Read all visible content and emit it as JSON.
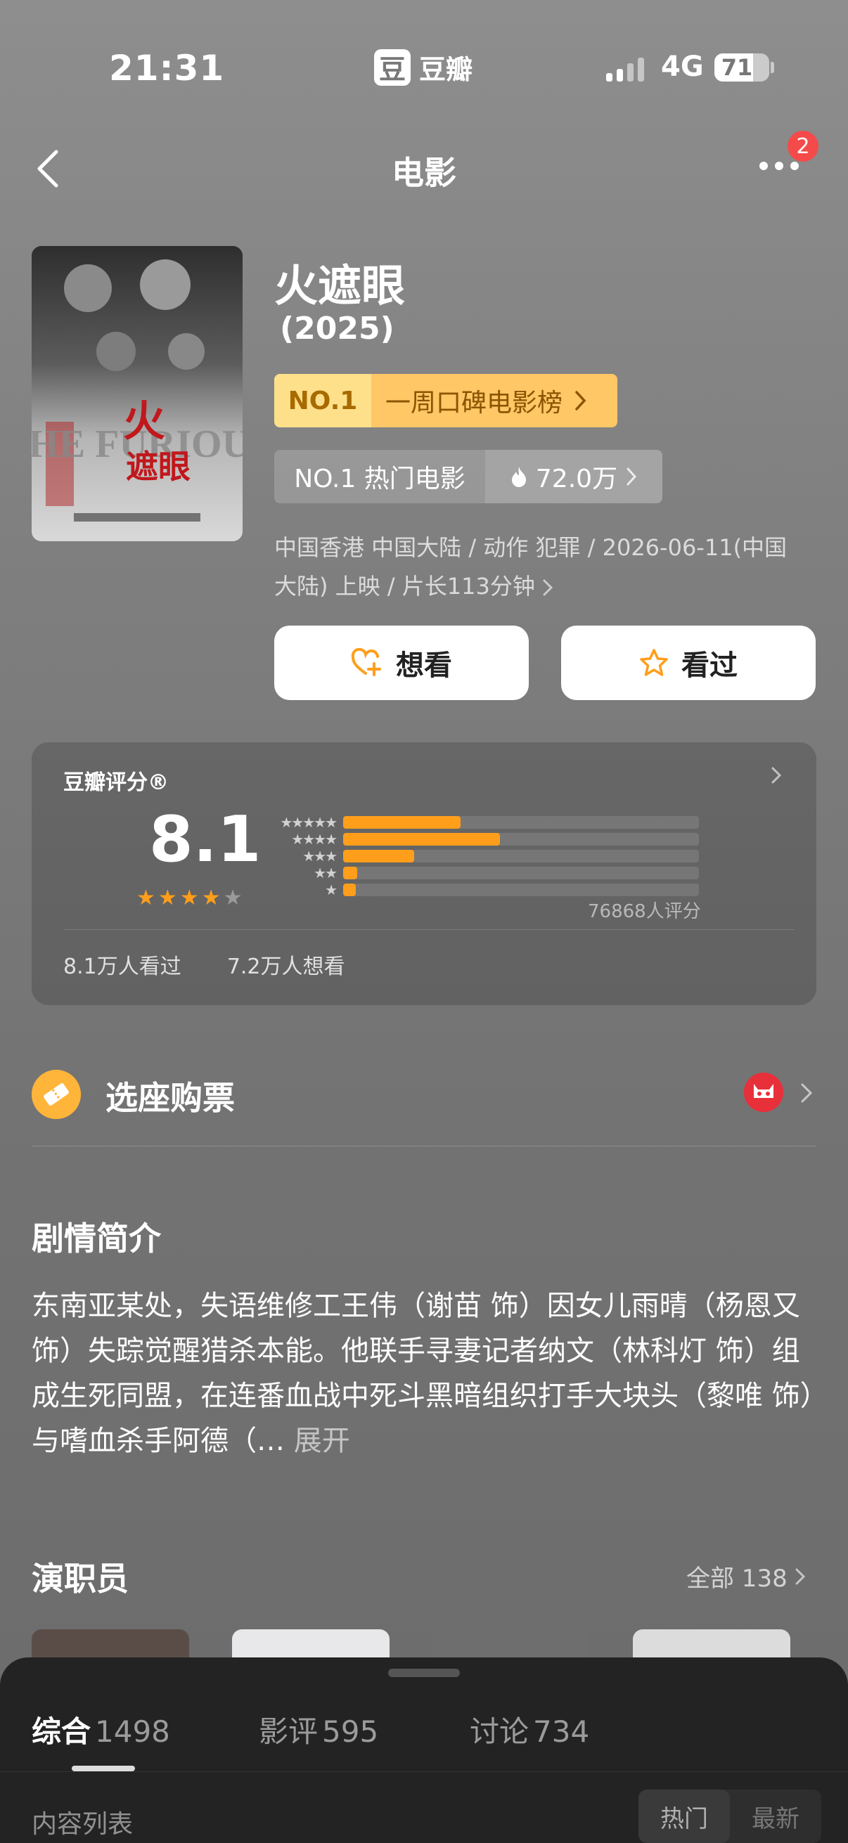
{
  "status_bar": {
    "time": "21:31",
    "app_logo": "豆",
    "app_name": "豆瓣",
    "network": "4G",
    "battery": "71",
    "battery_level": 0.71
  },
  "nav": {
    "title": "电影",
    "more_badge": "2"
  },
  "movie": {
    "title": "火遮眼",
    "year": "(2025)",
    "rank_badge": {
      "no": "NO.1",
      "text": "一周口碑电影榜"
    },
    "hot_badge": {
      "text": "NO.1 热门电影",
      "heat": "72.0万"
    },
    "meta": "中国香港 中国大陆 / 动作 犯罪 / 2026-06-11(中国大陆) 上映 / 片长113分钟"
  },
  "actions": {
    "want": "想看",
    "seen": "看过"
  },
  "rating": {
    "title": "豆瓣评分®",
    "score": "8.1",
    "stars": 4,
    "distribution": [
      0.33,
      0.44,
      0.2,
      0.04,
      0.035
    ],
    "count": "76868人评分",
    "seen": "8.1万人看过",
    "want": "7.2万人想看"
  },
  "ticket": {
    "label": "选座购票"
  },
  "synopsis": {
    "title": "剧情简介",
    "body": "东南亚某处，失语维修工王伟（谢苗 饰）因女儿雨晴（杨恩又 饰）失踪觉醒猎杀本能。他联手寻妻记者纳文（林科灯 饰）组成生死同盟，在连番血战中死斗黑暗组织打手大块头（黎唯 饰）与嗜血杀手阿德（",
    "more": "展开"
  },
  "cast": {
    "title": "演职员",
    "all": "全部 138"
  },
  "sheet": {
    "tabs": [
      {
        "label": "综合",
        "count": "1498"
      },
      {
        "label": "影评",
        "count": "595"
      },
      {
        "label": "讨论",
        "count": "734"
      }
    ],
    "list_label": "内容列表",
    "sort": [
      "热门",
      "最新"
    ]
  },
  "colors": {
    "accent": "#ff9e1b",
    "badge_red": "#f44a4a"
  },
  "icons": [
    "back-icon",
    "more-icon",
    "heart-plus-icon",
    "star-icon",
    "flame-icon",
    "chevron-right-icon",
    "ticket-icon",
    "maoyan-cat-icon"
  ]
}
